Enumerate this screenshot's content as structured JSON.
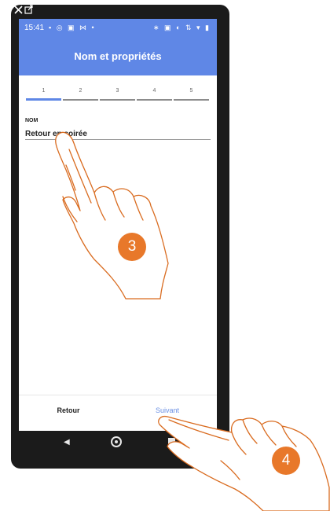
{
  "status_bar": {
    "time": "15:41",
    "left_icons": "▪ ◎ ▣ ⋈ •",
    "right_icons": "∗ ▣ ◐ ⇅ ▾ ▮"
  },
  "header": {
    "title": "Nom et propriétés"
  },
  "stepper": {
    "steps": [
      "1",
      "2",
      "3",
      "4",
      "5"
    ],
    "active_step": 1
  },
  "form": {
    "label": "NOM",
    "value": "Retour en soirée"
  },
  "footer": {
    "back_label": "Retour",
    "next_label": "Suivant"
  },
  "annotations": {
    "step_a": "3",
    "step_b": "4"
  },
  "colors": {
    "accent": "#5f87e6",
    "badge": "#e8782a",
    "hand_outline": "#d96b1f"
  }
}
